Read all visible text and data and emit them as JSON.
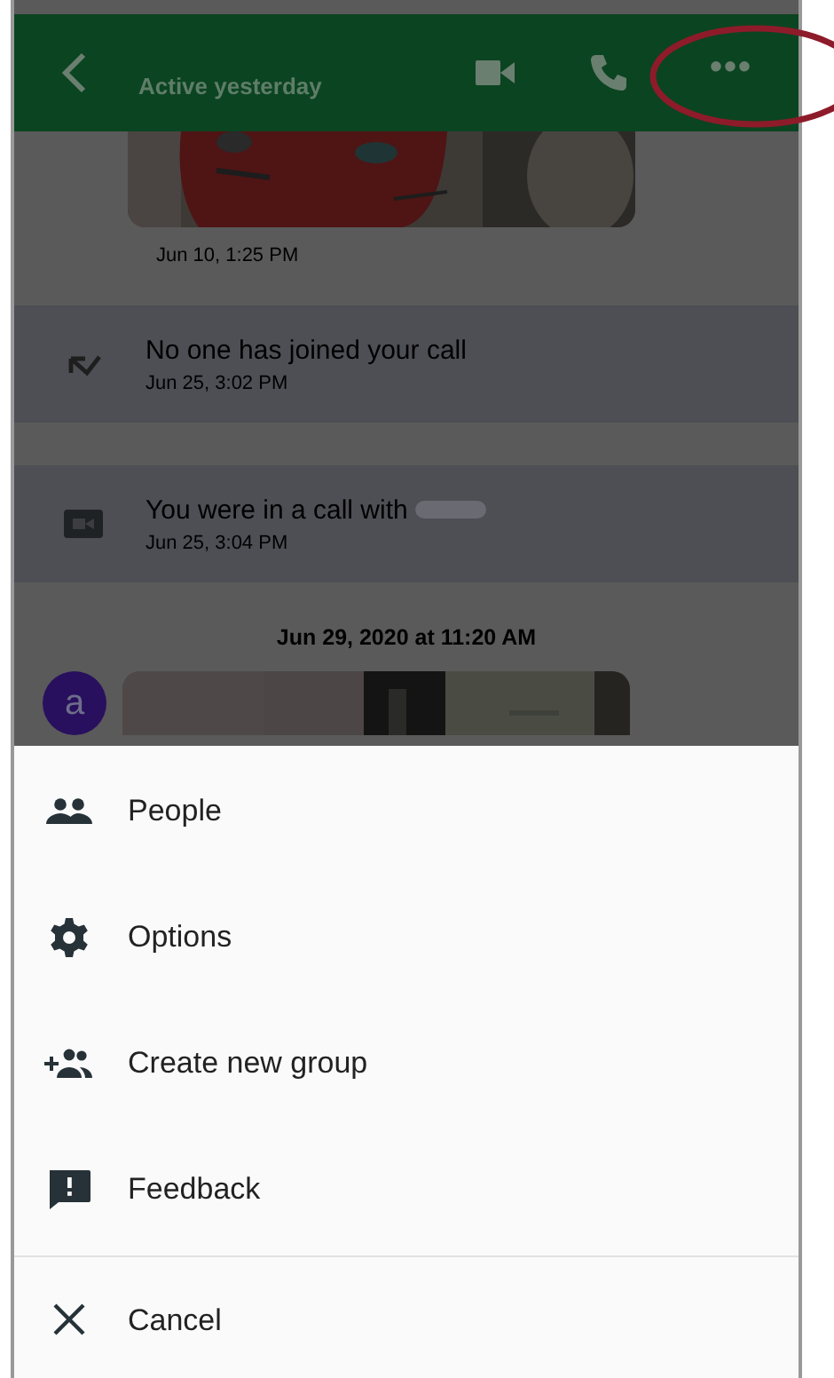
{
  "header": {
    "status": "Active yesterday",
    "more": "•••"
  },
  "messages": [
    {
      "time": "Jun 10, 1:25 PM"
    },
    {
      "kind": "missed-call",
      "text": "No one has joined your call",
      "time": "Jun 25, 3:02 PM"
    },
    {
      "kind": "video-call",
      "text": "You were in a call with",
      "time": "Jun 25, 3:04 PM"
    },
    {
      "kind": "date",
      "text": "Jun 29, 2020 at 11:20 AM"
    },
    {
      "kind": "avatar-photo",
      "avatar": "a"
    }
  ],
  "menu": [
    {
      "kind": "people",
      "label": "People"
    },
    {
      "kind": "options",
      "label": "Options"
    },
    {
      "kind": "create-group",
      "label": "Create new group"
    },
    {
      "kind": "feedback",
      "label": "Feedback"
    },
    {
      "kind": "cancel",
      "label": "Cancel"
    }
  ]
}
